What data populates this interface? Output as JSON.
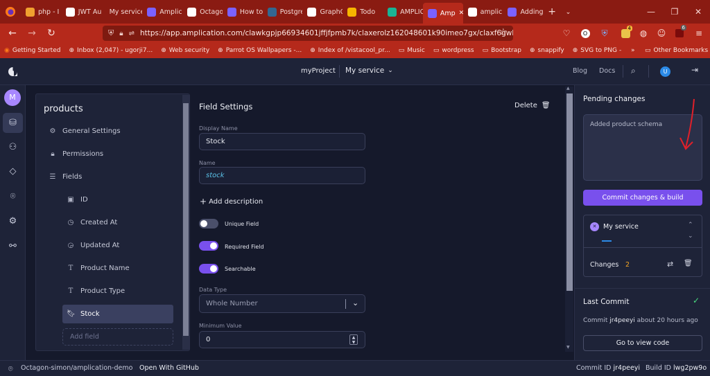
{
  "browser": {
    "tabs": [
      {
        "label": "php - I",
        "color": "#f0a030"
      },
      {
        "label": "JWT Au",
        "color": "#ffffff"
      },
      {
        "label": "My service",
        "color": ""
      },
      {
        "label": "Amplic",
        "color": "#7b61ff"
      },
      {
        "label": "Octago",
        "color": "#ffffff"
      },
      {
        "label": "How to",
        "color": "#7b61ff"
      },
      {
        "label": "Postgre",
        "color": "#336791"
      },
      {
        "label": "GraphQ",
        "color": "#ffffff"
      },
      {
        "label": "Todo",
        "color": "#f7b500"
      },
      {
        "label": "AMPLIC",
        "color": "#1ab394"
      },
      {
        "label": "Amp",
        "color": "#7b61ff"
      },
      {
        "label": "amplic",
        "color": "#ffffff"
      },
      {
        "label": "Adding",
        "color": "#7b61ff"
      }
    ],
    "url": "https://app.amplication.com/clawkgpjp66934601jffjfpmb7k/claxerolz1620486​01k90imeo7gx/claxf6gwb61850",
    "url_domain": "app.amplication.com",
    "ext_badge_1": "4",
    "ext_badge_2": "6",
    "bookmarks": [
      "Getting Started",
      "Inbox (2,047) - ugorji7...",
      "Web security",
      "Parrot OS Wallpapers -...",
      "Index of /vistacool_pr...",
      "Music",
      "wordpress",
      "Bootstrap",
      "snappify",
      "SVG to PNG – Convert ..."
    ],
    "other_bookmarks": "Other Bookmarks"
  },
  "header": {
    "project": "myProject",
    "service": "My service",
    "blog": "Blog",
    "docs": "Docs",
    "user_initial": "U"
  },
  "rail": {
    "workspace_initial": "M"
  },
  "entity": {
    "title": "products",
    "items": [
      {
        "label": "General Settings"
      },
      {
        "label": "Permissions"
      },
      {
        "label": "Fields"
      }
    ],
    "fields": [
      {
        "label": "ID"
      },
      {
        "label": "Created At"
      },
      {
        "label": "Updated At"
      },
      {
        "label": "Product Name"
      },
      {
        "label": "Product Type"
      },
      {
        "label": "Stock"
      }
    ],
    "add_field_placeholder": "Add field"
  },
  "field_settings": {
    "title": "Field Settings",
    "delete_label": "Delete",
    "display_name_label": "Display Name",
    "display_name_value": "Stock",
    "name_label": "Name",
    "name_value": "stock",
    "add_description": "Add description",
    "unique_label": "Unique Field",
    "unique_on": false,
    "required_label": "Required Field",
    "required_on": true,
    "searchable_label": "Searchable",
    "searchable_on": true,
    "data_type_label": "Data Type",
    "data_type_value": "Whole Number",
    "min_value_label": "Minimum Value",
    "min_value": "0"
  },
  "pending": {
    "title": "Pending changes",
    "message": "Added product schema",
    "commit_button": "Commit changes & build",
    "service_name": "My service",
    "changes_label": "Changes",
    "changes_count": "2"
  },
  "last_commit": {
    "title": "Last Commit",
    "commit_prefix": "Commit",
    "commit_id": "jr4peeyi",
    "time_ago": "about 20 hours ago",
    "view_code_button": "Go to view code"
  },
  "footer": {
    "repo": "Octagon-simon/amplication-demo",
    "open_github": "Open With GitHub",
    "commit_id_label": "Commit ID",
    "commit_id": "jr4peeyi",
    "build_id_label": "Build ID",
    "build_id": "lwg2pw9o"
  },
  "colors": {
    "accent": "#7950ed",
    "browser_chrome": "#b5291b",
    "success": "#4ade80",
    "changes_count": "#f5a623",
    "annotation_arrow": "#e0202a"
  }
}
